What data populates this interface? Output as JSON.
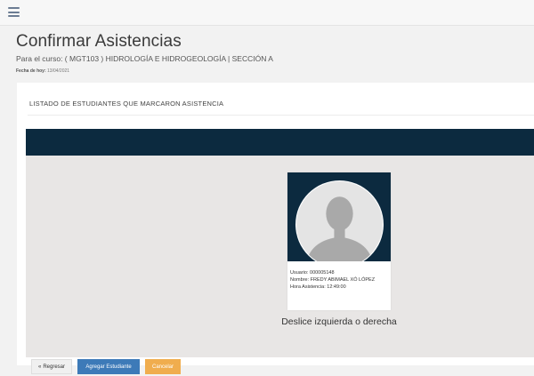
{
  "header": {
    "menu_icon": "hamburger-menu-icon"
  },
  "page": {
    "title": "Confirmar Asistencias",
    "subtitle": "Para el curso: ( MGT103 ) HIDROLOGÍA E HIDROGEOLOGÍA | SECCIÓN A",
    "date_label": "Fecha de hoy:",
    "date_value": "13/04/2021"
  },
  "list": {
    "heading": "LISTADO DE ESTUDIANTES QUE MARCARON ASISTENCIA"
  },
  "student": {
    "avatar_icon": "user-avatar-placeholder-icon",
    "usuario": "Usuario: 000005148",
    "nombre": "Nombre: FREDY ABIMAEL XÓ LÓPEZ",
    "hora": "Hora Asistencia: 12:49:00"
  },
  "swipe_hint": "Deslice izquierda o derecha",
  "buttons": {
    "back_icon": "chevron-double-left-icon",
    "back": "Regresar",
    "add": "Agregar Estudiante",
    "cancel": "Cancelar"
  },
  "colors": {
    "dark_navy": "#0c2a3f",
    "primary": "#3d7ab8",
    "warning": "#f0ad4e",
    "slider_bg": "#e8e6e5"
  }
}
